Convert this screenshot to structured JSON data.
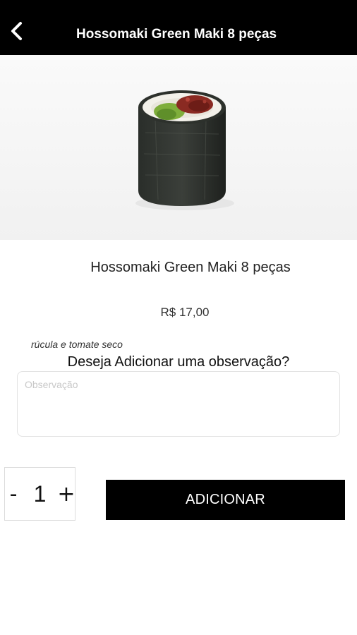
{
  "header": {
    "title": "Hossomaki Green Maki 8 peças",
    "back_icon": "chevron-left-icon"
  },
  "product": {
    "image": "sushi-roll-image",
    "name": "Hossomaki Green Maki 8 peças",
    "price": "R$ 17,00",
    "description": "rúcula e tomate seco"
  },
  "observation": {
    "question": "Deseja Adicionar uma observação?",
    "placeholder": "Observação",
    "value": ""
  },
  "quantity": {
    "decrement_label": "-",
    "value": "1",
    "increment_label": "+"
  },
  "actions": {
    "add_label": "ADICIONAR"
  },
  "colors": {
    "header_bg": "#000000",
    "primary_button": "#000000",
    "text_on_dark": "#ffffff"
  }
}
